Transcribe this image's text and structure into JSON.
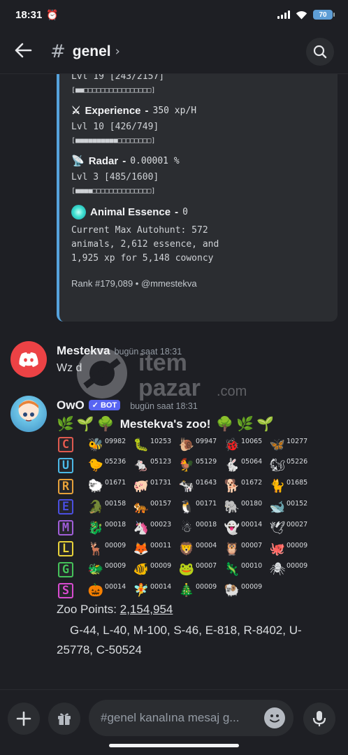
{
  "status": {
    "time": "18:31",
    "battery": "70"
  },
  "header": {
    "channel": "genel"
  },
  "embed": {
    "top_partial": "Lvl 19 [243/2157]",
    "top_bar": "[■■□□□□□□□□□□□□□□□□]",
    "experience": {
      "title": "Experience",
      "value": "350 xp/H",
      "level": "Lvl 10 [426/749]",
      "bar": "[■■■■■■■■■■□□□□□□□□]"
    },
    "radar": {
      "title": "Radar",
      "value": "0.00001 %",
      "level": "Lvl 3 [485/1600]",
      "bar": "[■■■■□□□□□□□□□□□□□□]"
    },
    "essence": {
      "title": "Animal Essence",
      "value": "0",
      "text": "Current Max Autohunt: 572 animals, 2,612 essence, and 1,925 xp for 5,148 cowoncy"
    },
    "rank": "Rank #179,089 • @mmestekva"
  },
  "messages": [
    {
      "author": "Mestekva",
      "time": "bugün saat 18:31",
      "text": "Wz d"
    },
    {
      "author": "OwO",
      "badge": "BOT",
      "time": "bugün saat 18:31"
    }
  ],
  "zoo": {
    "title": "Mestekva's zoo!",
    "rows": [
      {
        "tier": "C",
        "color": "#e05a4f",
        "animals": [
          {
            "e": "🐝",
            "n": "09982"
          },
          {
            "e": "🐛",
            "n": "10253"
          },
          {
            "e": "🐌",
            "n": "09947"
          },
          {
            "e": "🐞",
            "n": "10065"
          },
          {
            "e": "🦋",
            "n": "10277"
          }
        ]
      },
      {
        "tier": "U",
        "color": "#4bb8e6",
        "animals": [
          {
            "e": "🐤",
            "n": "05236"
          },
          {
            "e": "🐁",
            "n": "05123"
          },
          {
            "e": "🐓",
            "n": "05129"
          },
          {
            "e": "🐇",
            "n": "05064"
          },
          {
            "e": "🐿",
            "n": "05226"
          }
        ]
      },
      {
        "tier": "R",
        "color": "#e6a13a",
        "animals": [
          {
            "e": "🐑",
            "n": "01671"
          },
          {
            "e": "🐖",
            "n": "01731"
          },
          {
            "e": "🐄",
            "n": "01643"
          },
          {
            "e": "🐕",
            "n": "01672"
          },
          {
            "e": "🐈",
            "n": "01685"
          }
        ]
      },
      {
        "tier": "E",
        "color": "#4a4fe0",
        "animals": [
          {
            "e": "🐊",
            "n": "00158"
          },
          {
            "e": "🐅",
            "n": "00157"
          },
          {
            "e": "🐧",
            "n": "00171"
          },
          {
            "e": "🐘",
            "n": "00180"
          },
          {
            "e": "🐋",
            "n": "00152"
          }
        ]
      },
      {
        "tier": "M",
        "color": "#a05ed8",
        "animals": [
          {
            "e": "🐉",
            "n": "00018"
          },
          {
            "e": "🦄",
            "n": "00023"
          },
          {
            "e": "☃",
            "n": "00018"
          },
          {
            "e": "👻",
            "n": "00014"
          },
          {
            "e": "🕊",
            "n": "00027"
          }
        ]
      },
      {
        "tier": "L",
        "color": "#e8d23a",
        "animals": [
          {
            "e": "🦌",
            "n": "00009"
          },
          {
            "e": "🦊",
            "n": "00011"
          },
          {
            "e": "🦁",
            "n": "00004"
          },
          {
            "e": "🦉",
            "n": "00007"
          },
          {
            "e": "🐙",
            "n": "00009"
          }
        ]
      },
      {
        "tier": "G",
        "color": "#45c25a",
        "animals": [
          {
            "e": "🐲",
            "n": "00009"
          },
          {
            "e": "🐠",
            "n": "00009"
          },
          {
            "e": "🐸",
            "n": "00007"
          },
          {
            "e": "🦎",
            "n": "00010"
          },
          {
            "e": "🕷",
            "n": "00009"
          }
        ]
      },
      {
        "tier": "S",
        "color": "#d84bd0",
        "animals": [
          {
            "e": "🎃",
            "n": "00014"
          },
          {
            "e": "🧚",
            "n": "00014"
          },
          {
            "e": "🎄",
            "n": "00009"
          },
          {
            "e": "🐏",
            "n": "00009"
          }
        ]
      }
    ],
    "points_label": "Zoo Points:",
    "points_value": "2,154,954",
    "counts": "G-44, L-40, M-100, S-46, E-818, R-8402, U-25778, C-50524"
  },
  "watermark": {
    "line1": "item",
    "line2": "pazar",
    "suffix": ".com"
  },
  "input": {
    "placeholder": "#genel kanalına mesaj g..."
  }
}
